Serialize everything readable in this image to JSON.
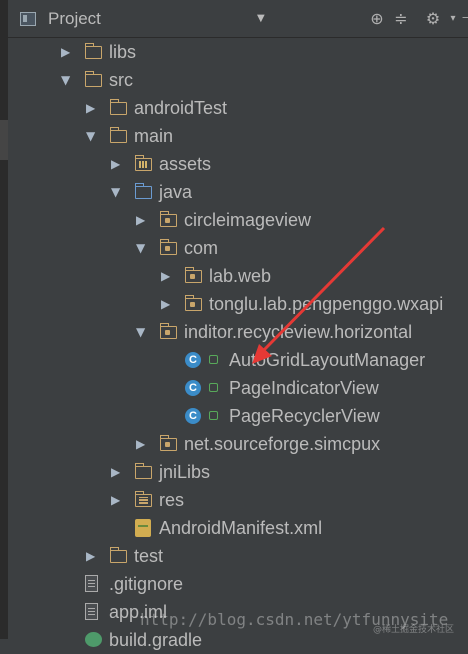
{
  "header": {
    "title": "Project",
    "icons": [
      "target-icon",
      "collapse-icon",
      "gear-icon",
      "hide-icon"
    ]
  },
  "tree": [
    {
      "label": "libs",
      "depth": 1,
      "arrow": "right",
      "icon": "folder"
    },
    {
      "label": "src",
      "depth": 1,
      "arrow": "down",
      "icon": "folder"
    },
    {
      "label": "androidTest",
      "depth": 2,
      "arrow": "right",
      "icon": "folder"
    },
    {
      "label": "main",
      "depth": 2,
      "arrow": "down",
      "icon": "folder"
    },
    {
      "label": "assets",
      "depth": 3,
      "arrow": "right",
      "icon": "assets-folder"
    },
    {
      "label": "java",
      "depth": 3,
      "arrow": "down",
      "icon": "source-folder"
    },
    {
      "label": "circleimageview",
      "depth": 4,
      "arrow": "right",
      "icon": "package-folder"
    },
    {
      "label": "com",
      "depth": 4,
      "arrow": "down",
      "icon": "package-folder"
    },
    {
      "label": "lab.web",
      "depth": 5,
      "arrow": "right",
      "icon": "package-folder"
    },
    {
      "label": "tonglu.lab.pengpenggo.wxapi",
      "depth": 5,
      "arrow": "right",
      "icon": "package-folder"
    },
    {
      "label": "inditor.recycleview.horizontal",
      "depth": 4,
      "arrow": "down",
      "icon": "package-folder"
    },
    {
      "label": "AutoGridLayoutManager",
      "depth": 5,
      "arrow": "none",
      "icon": "class"
    },
    {
      "label": "PageIndicatorView",
      "depth": 5,
      "arrow": "none",
      "icon": "class"
    },
    {
      "label": "PageRecyclerView",
      "depth": 5,
      "arrow": "none",
      "icon": "class"
    },
    {
      "label": "net.sourceforge.simcpux",
      "depth": 4,
      "arrow": "right",
      "icon": "package-folder"
    },
    {
      "label": "jniLibs",
      "depth": 3,
      "arrow": "right",
      "icon": "folder"
    },
    {
      "label": "res",
      "depth": 3,
      "arrow": "right",
      "icon": "res-folder"
    },
    {
      "label": "AndroidManifest.xml",
      "depth": 3,
      "arrow": "none",
      "icon": "xml-file"
    },
    {
      "label": "test",
      "depth": 2,
      "arrow": "right",
      "icon": "folder"
    },
    {
      "label": ".gitignore",
      "depth": 1,
      "arrow": "none",
      "icon": "text-file"
    },
    {
      "label": "app.iml",
      "depth": 1,
      "arrow": "none",
      "icon": "module-file"
    },
    {
      "label": "build.gradle",
      "depth": 1,
      "arrow": "none",
      "icon": "gradle-file"
    }
  ],
  "class_icon_letter": "C",
  "colors": {
    "background": "#3c3f41",
    "text": "#bbbbbb",
    "folder": "#c9a66b",
    "source_folder": "#6b9bd1",
    "class_icon": "#3b8cc8",
    "annotation_arrow": "#e53935"
  },
  "watermark": "http://blog.csdn.net/ytfunnysite",
  "watermark_small": "@稀土掘金技术社区"
}
